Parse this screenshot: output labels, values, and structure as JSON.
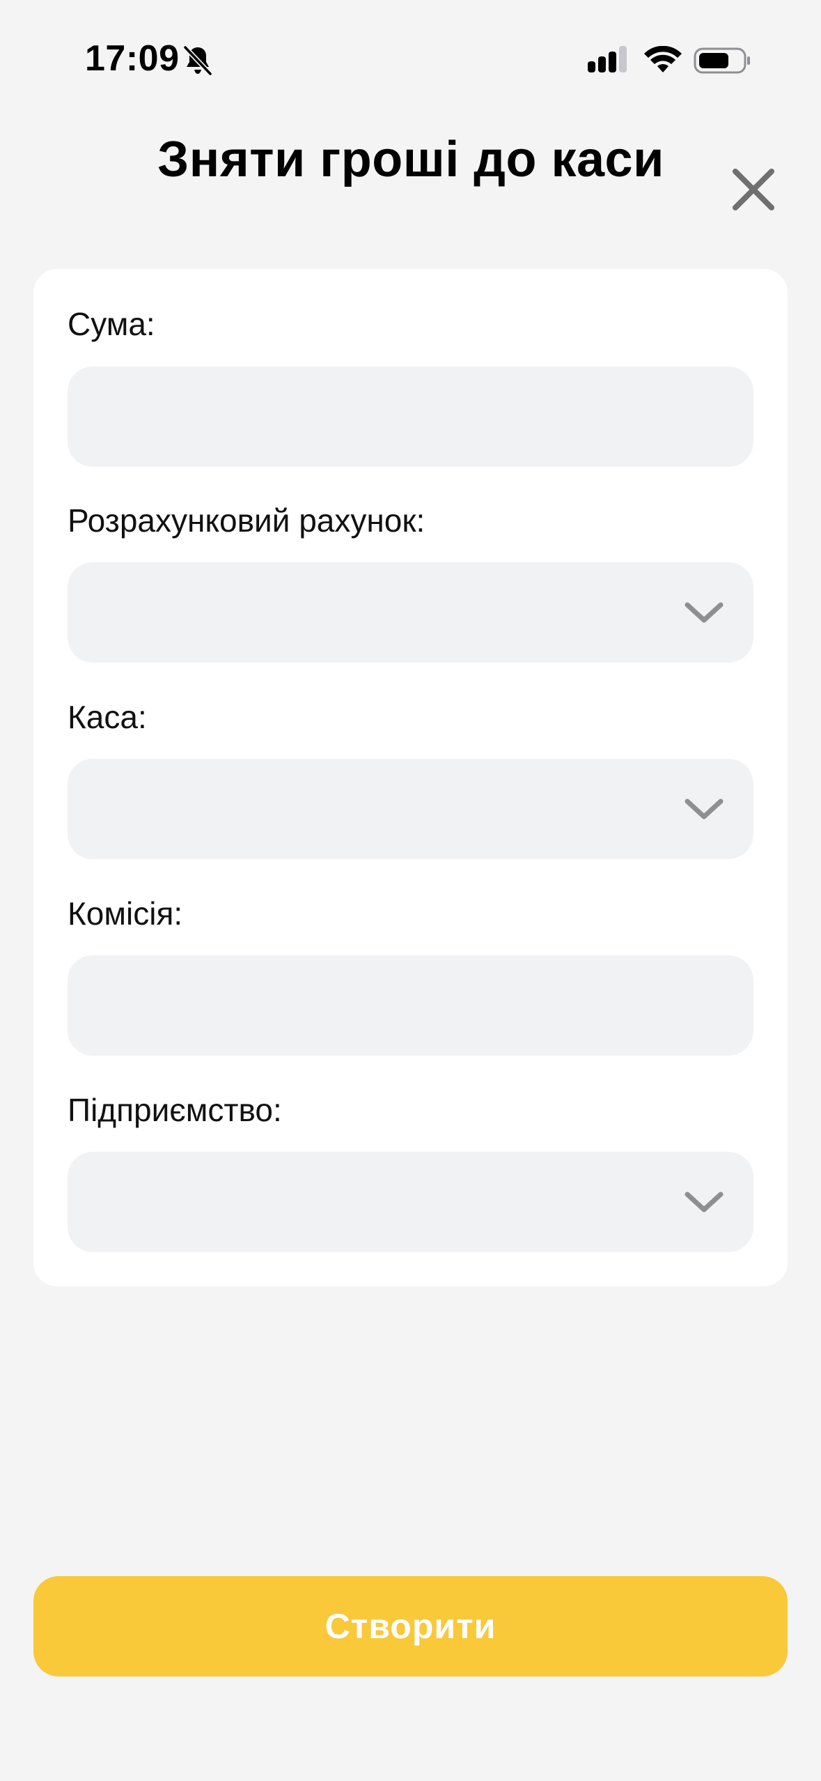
{
  "status_bar": {
    "time": "17:09",
    "icons": [
      "bell-off-icon",
      "signal-icon",
      "wifi-icon",
      "battery-icon"
    ]
  },
  "header": {
    "title": "Зняти гроші до каси",
    "close_icon": "close-icon"
  },
  "form": {
    "fields": [
      {
        "label": "Сума:",
        "type": "input",
        "value": ""
      },
      {
        "label": "Розрахунковий рахунок:",
        "type": "select",
        "value": ""
      },
      {
        "label": "Каса:",
        "type": "select",
        "value": ""
      },
      {
        "label": "Комісія:",
        "type": "input",
        "value": ""
      },
      {
        "label": "Підприємство:",
        "type": "select",
        "value": ""
      }
    ]
  },
  "actions": {
    "create_label": "Створити"
  },
  "colors": {
    "background": "#f4f4f5",
    "card": "#ffffff",
    "field": "#f1f2f4",
    "accent": "#f9c93a",
    "chevron": "#8e8e93"
  }
}
